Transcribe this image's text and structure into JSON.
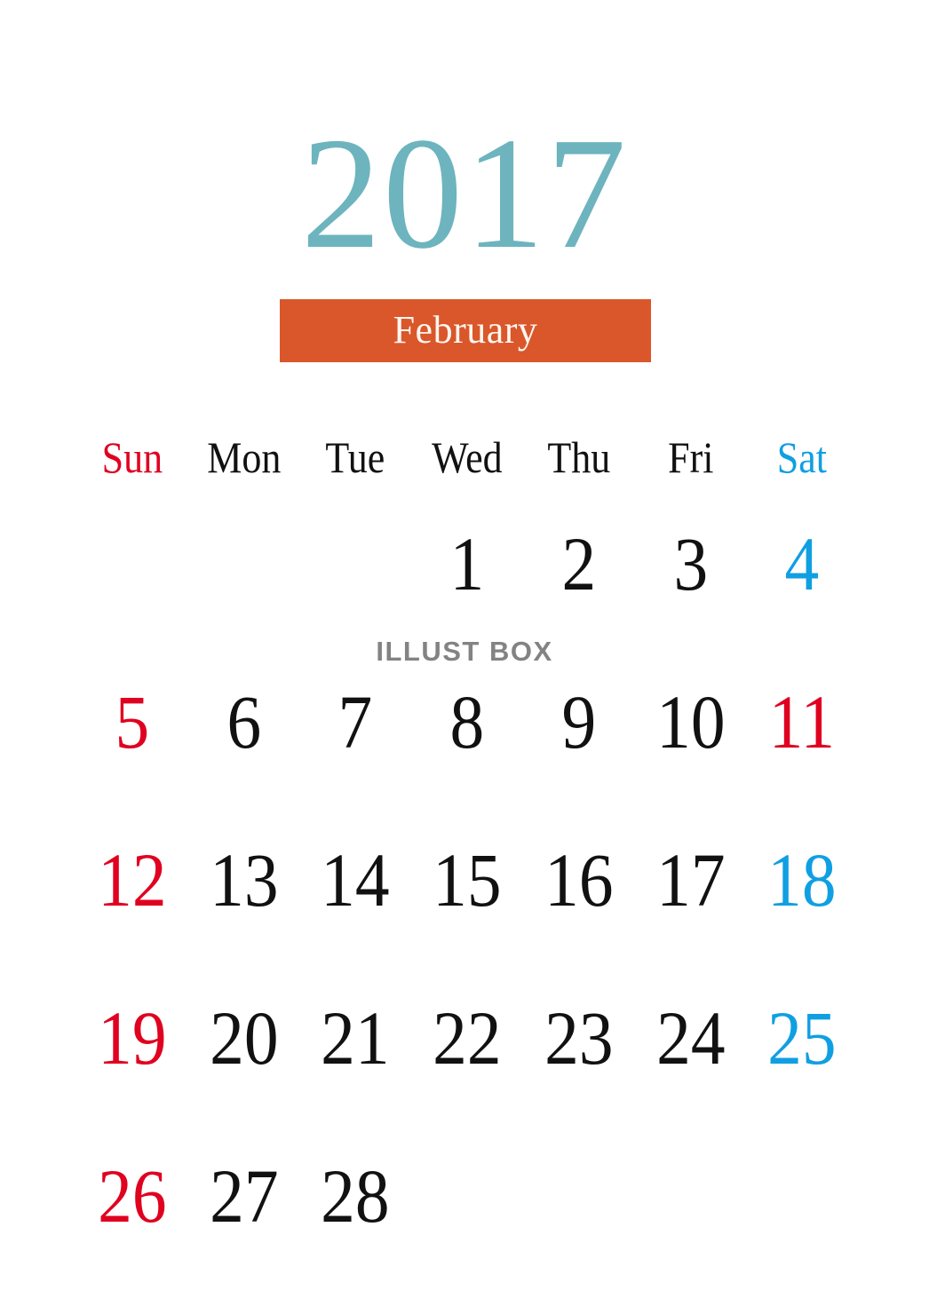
{
  "calendar": {
    "year": "2017",
    "month_label": "February",
    "weekdays": [
      {
        "label": "Sun",
        "kind": "sun"
      },
      {
        "label": "Mon",
        "kind": "weekday"
      },
      {
        "label": "Tue",
        "kind": "weekday"
      },
      {
        "label": "Wed",
        "kind": "weekday"
      },
      {
        "label": "Thu",
        "kind": "weekday"
      },
      {
        "label": "Fri",
        "kind": "weekday"
      },
      {
        "label": "Sat",
        "kind": "sat"
      }
    ],
    "weeks": [
      [
        {
          "label": "",
          "kind": "empty"
        },
        {
          "label": "",
          "kind": "empty"
        },
        {
          "label": "",
          "kind": "empty"
        },
        {
          "label": "1",
          "kind": "weekday"
        },
        {
          "label": "2",
          "kind": "weekday"
        },
        {
          "label": "3",
          "kind": "weekday"
        },
        {
          "label": "4",
          "kind": "sat"
        }
      ],
      [
        {
          "label": "5",
          "kind": "sun"
        },
        {
          "label": "6",
          "kind": "weekday"
        },
        {
          "label": "7",
          "kind": "weekday"
        },
        {
          "label": "8",
          "kind": "weekday"
        },
        {
          "label": "9",
          "kind": "weekday"
        },
        {
          "label": "10",
          "kind": "weekday"
        },
        {
          "label": "11",
          "kind": "holiday"
        }
      ],
      [
        {
          "label": "12",
          "kind": "sun"
        },
        {
          "label": "13",
          "kind": "weekday"
        },
        {
          "label": "14",
          "kind": "weekday"
        },
        {
          "label": "15",
          "kind": "weekday"
        },
        {
          "label": "16",
          "kind": "weekday"
        },
        {
          "label": "17",
          "kind": "weekday"
        },
        {
          "label": "18",
          "kind": "sat"
        }
      ],
      [
        {
          "label": "19",
          "kind": "sun"
        },
        {
          "label": "20",
          "kind": "weekday"
        },
        {
          "label": "21",
          "kind": "weekday"
        },
        {
          "label": "22",
          "kind": "weekday"
        },
        {
          "label": "23",
          "kind": "weekday"
        },
        {
          "label": "24",
          "kind": "weekday"
        },
        {
          "label": "25",
          "kind": "sat"
        }
      ],
      [
        {
          "label": "26",
          "kind": "sun"
        },
        {
          "label": "27",
          "kind": "weekday"
        },
        {
          "label": "28",
          "kind": "weekday"
        },
        {
          "label": "",
          "kind": "empty"
        },
        {
          "label": "",
          "kind": "empty"
        },
        {
          "label": "",
          "kind": "empty"
        },
        {
          "label": "",
          "kind": "empty"
        }
      ]
    ]
  },
  "watermark": {
    "text": "ILLUST BOX"
  },
  "colors": {
    "year_teal": "#6db4be",
    "banner_orange": "#d9572a",
    "banner_text": "#fdf6f0",
    "sunday_red": "#e00020",
    "saturday_blue": "#109fe2",
    "weekday_black": "#111111",
    "watermark_gray": "#838383",
    "background": "#ffffff"
  }
}
